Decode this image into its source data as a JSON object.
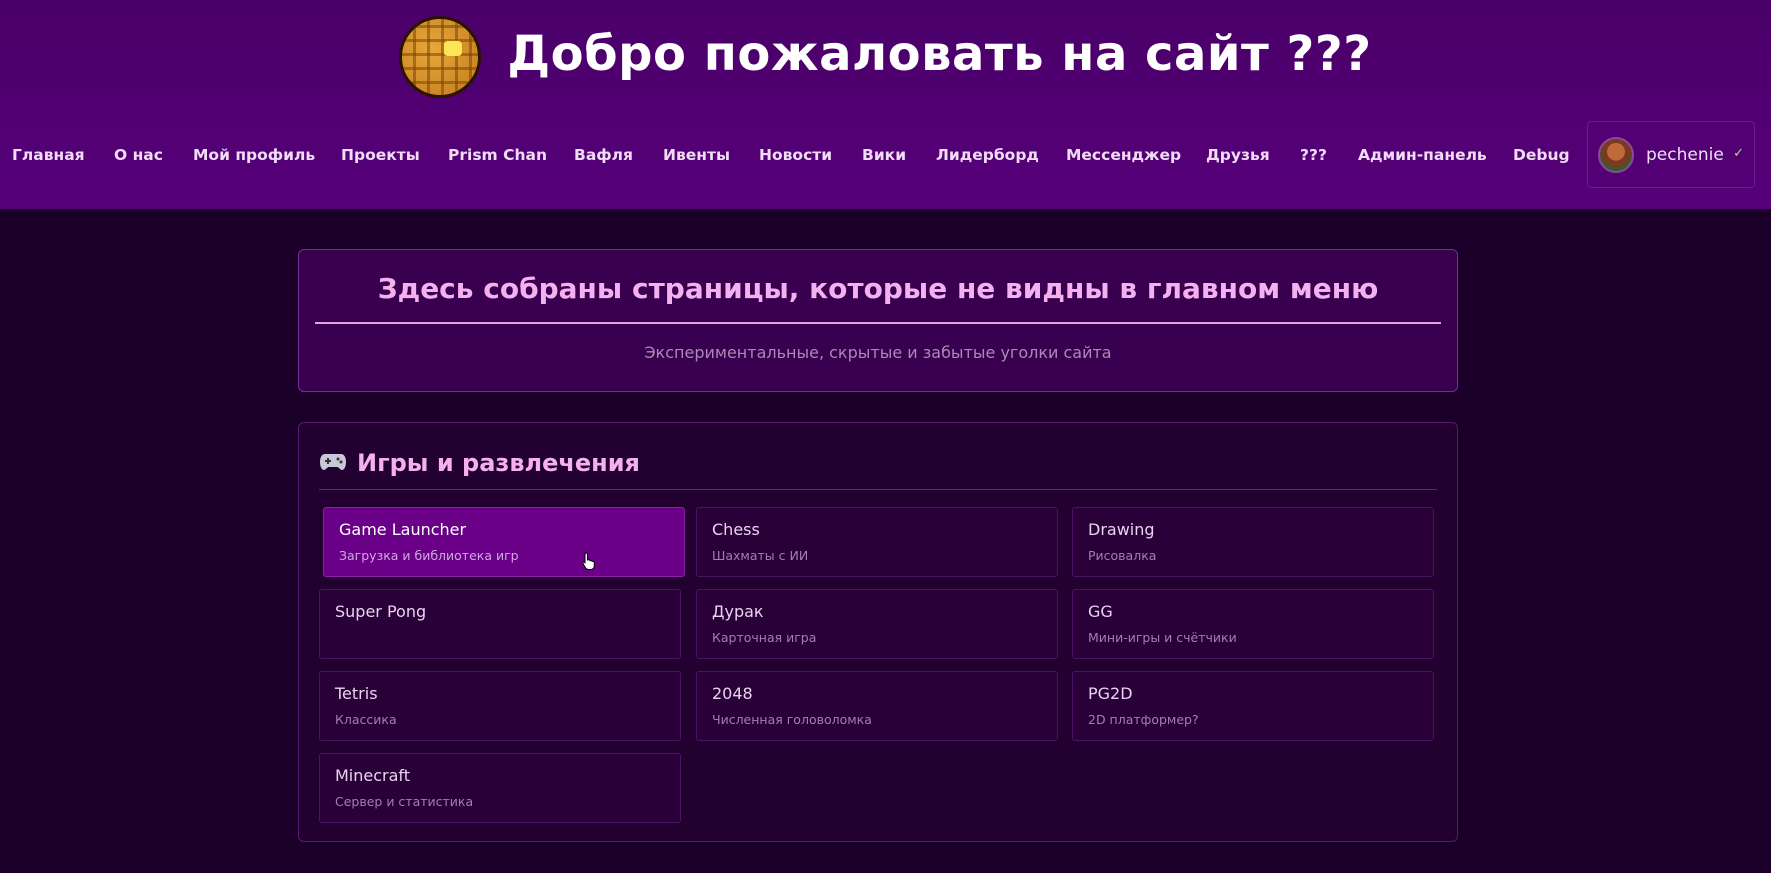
{
  "header": {
    "title": "Добро пожаловать на сайт ???",
    "nav": [
      {
        "label": "Главная"
      },
      {
        "label": "О нас"
      },
      {
        "label": "Мой профиль"
      },
      {
        "label": "Проекты"
      },
      {
        "label": "Prism Chan"
      },
      {
        "label": "Вафля"
      },
      {
        "label": "Ивенты"
      },
      {
        "label": "Новости"
      },
      {
        "label": "Вики"
      },
      {
        "label": "Лидерборд"
      },
      {
        "label": "Мессенджер"
      },
      {
        "label": "Друзья"
      },
      {
        "label": "???"
      },
      {
        "label": "Админ-панель"
      },
      {
        "label": "Debug"
      }
    ],
    "user": {
      "name": "pechenie",
      "status_icon": "check-icon"
    }
  },
  "intro": {
    "title": "Здесь собраны страницы, которые не видны в главном меню",
    "subtitle": "Экспериментальные, скрытые и забытые уголки сайта"
  },
  "games": {
    "icon": "gamepad-icon",
    "title": "Игры и развлечения",
    "cards": [
      {
        "title": "Game Launcher",
        "desc": "Загрузка и библиотека игр",
        "active": true
      },
      {
        "title": "Chess",
        "desc": "Шахматы с ИИ"
      },
      {
        "title": "Drawing",
        "desc": "Рисовалка"
      },
      {
        "title": "Super Pong",
        "desc": ""
      },
      {
        "title": "Дурак",
        "desc": "Карточная игра"
      },
      {
        "title": "GG",
        "desc": "Мини-игры и счётчики"
      },
      {
        "title": "Tetris",
        "desc": "Классика"
      },
      {
        "title": "2048",
        "desc": "Численная головоломка"
      },
      {
        "title": "PG2D",
        "desc": "2D платформер?"
      },
      {
        "title": "Minecraft",
        "desc": "Сервер и статистика"
      }
    ]
  },
  "colors": {
    "header_bg": "#4a0068",
    "page_bg": "#1a0029",
    "accent_pink": "#f5b0f0",
    "active_card": "#6a0088"
  }
}
